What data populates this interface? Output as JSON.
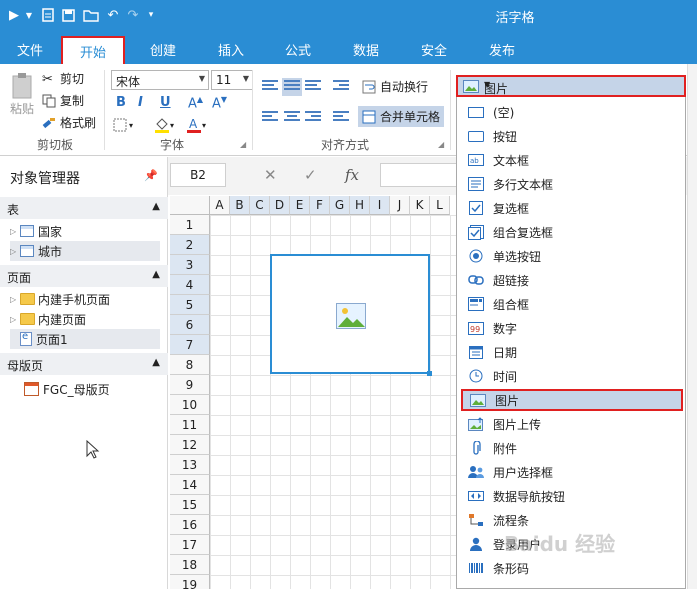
{
  "app": {
    "title": "活字格"
  },
  "tabs": [
    {
      "label": "文件"
    },
    {
      "label": "开始"
    },
    {
      "label": "创建"
    },
    {
      "label": "插入"
    },
    {
      "label": "公式"
    },
    {
      "label": "数据"
    },
    {
      "label": "安全"
    },
    {
      "label": "发布"
    }
  ],
  "ribbon": {
    "clipboard": {
      "paste": "粘贴",
      "cut": "剪切",
      "copy": "复制",
      "format_painter": "格式刷",
      "group": "剪切板"
    },
    "font": {
      "name": "宋体",
      "size": "11",
      "group": "字体",
      "bold": "B",
      "italic": "I",
      "underline": "U"
    },
    "alignment": {
      "wrap": "自动换行",
      "merge": "合并单元格",
      "group": "对齐方式"
    },
    "cell_type": {
      "selected": "图片"
    }
  },
  "object_manager": {
    "title": "对象管理器",
    "sections": [
      {
        "header": "表",
        "items": [
          "国家",
          "城市"
        ]
      },
      {
        "header": "页面",
        "items": [
          "内建手机页面",
          "内建页面",
          "页面1"
        ]
      },
      {
        "header": "母版页",
        "items": [
          "FGC_母版页"
        ]
      }
    ]
  },
  "formula_bar": {
    "name_box": "B2",
    "fx": "fx"
  },
  "grid": {
    "columns": [
      "A",
      "B",
      "C",
      "D",
      "E",
      "F",
      "G",
      "H",
      "I",
      "J",
      "K",
      "L"
    ],
    "rows": [
      "1",
      "2",
      "3",
      "4",
      "5",
      "6",
      "7",
      "8",
      "9",
      "10",
      "11",
      "12",
      "13",
      "14",
      "15",
      "16",
      "17",
      "18",
      "19"
    ]
  },
  "dropdown": {
    "items": [
      {
        "label": "(空)",
        "icon": "empty-icon"
      },
      {
        "label": "按钮",
        "icon": "button-icon"
      },
      {
        "label": "文本框",
        "icon": "textbox-icon"
      },
      {
        "label": "多行文本框",
        "icon": "multiline-textbox-icon"
      },
      {
        "label": "复选框",
        "icon": "checkbox-icon"
      },
      {
        "label": "组合复选框",
        "icon": "checkbox-group-icon"
      },
      {
        "label": "单选按钮",
        "icon": "radio-icon"
      },
      {
        "label": "超链接",
        "icon": "hyperlink-icon"
      },
      {
        "label": "组合框",
        "icon": "combobox-icon"
      },
      {
        "label": "数字",
        "icon": "number-icon"
      },
      {
        "label": "日期",
        "icon": "date-icon"
      },
      {
        "label": "时间",
        "icon": "time-icon"
      },
      {
        "label": "图片",
        "icon": "image-icon"
      },
      {
        "label": "图片上传",
        "icon": "image-upload-icon"
      },
      {
        "label": "附件",
        "icon": "attachment-icon"
      },
      {
        "label": "用户选择框",
        "icon": "user-select-icon"
      },
      {
        "label": "数据导航按钮",
        "icon": "data-nav-icon"
      },
      {
        "label": "流程条",
        "icon": "process-bar-icon"
      },
      {
        "label": "登录用户",
        "icon": "login-user-icon"
      },
      {
        "label": "条形码",
        "icon": "barcode-icon"
      }
    ],
    "selected_label": "图片"
  },
  "watermark": "Baidu 经验"
}
